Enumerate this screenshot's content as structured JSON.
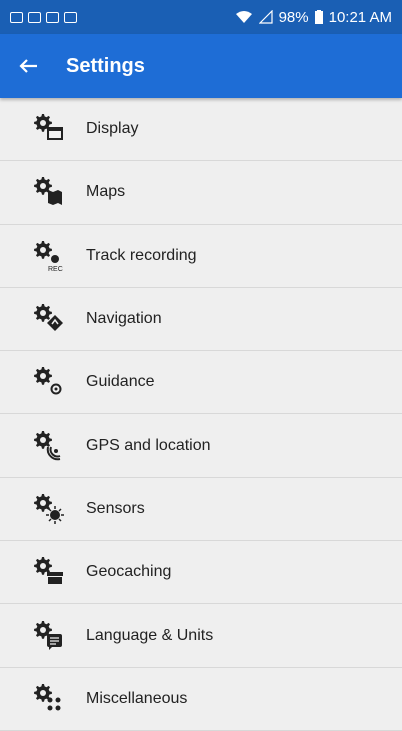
{
  "status": {
    "battery": "98%",
    "time": "10:21 AM"
  },
  "appbar": {
    "back_icon": "arrow-left-icon",
    "title": "Settings"
  },
  "items": [
    {
      "label": "Display",
      "icon": "gear-display-icon"
    },
    {
      "label": "Maps",
      "icon": "gear-map-icon"
    },
    {
      "label": "Track recording",
      "icon": "gear-rec-icon"
    },
    {
      "label": "Navigation",
      "icon": "gear-navigation-icon"
    },
    {
      "label": "Guidance",
      "icon": "gear-guidance-icon"
    },
    {
      "label": "GPS and location",
      "icon": "gear-gps-icon"
    },
    {
      "label": "Sensors",
      "icon": "gear-sensor-icon"
    },
    {
      "label": "Geocaching",
      "icon": "gear-geocache-icon"
    },
    {
      "label": "Language & Units",
      "icon": "gear-language-icon"
    },
    {
      "label": "Miscellaneous",
      "icon": "gear-misc-icon"
    }
  ],
  "colors": {
    "statusbar": "#1a5fb4",
    "appbar": "#1e6dd6",
    "background": "#efefef"
  }
}
